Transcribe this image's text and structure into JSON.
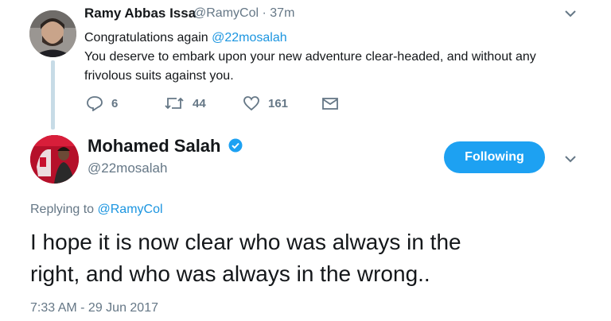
{
  "parent_tweet": {
    "author_name": "Ramy Abbas Issa",
    "handle": "@RamyCol",
    "separator": "·",
    "time_ago": "37m",
    "text_line1": "Congratulations again",
    "mention": "@22mosalah",
    "text_line2": "You deserve to embark upon your new adventure clear-headed, and without any",
    "text_line3": "frivolous suits against you.",
    "reply_count": "6",
    "retweet_count": "44",
    "like_count": "161"
  },
  "main_tweet": {
    "author_name": "Mohamed Salah",
    "handle": "@22mosalah",
    "follow_label": "Following",
    "replying_prefix": "Replying to",
    "replying_to": "@RamyCol",
    "text_line1": "I hope it is now clear who was always in the",
    "text_line2": "right, and who was always in the wrong..",
    "timestamp": "7:33 AM - 29 Jun 2017"
  },
  "colors": {
    "accent": "#1da1f2",
    "mention": "#1b95e0",
    "muted": "#657786",
    "thread_line": "#c7dbe6"
  },
  "icons": [
    "chevron-down-icon",
    "reply-icon",
    "retweet-icon",
    "like-icon",
    "direct-message-icon",
    "verified-badge-icon"
  ]
}
